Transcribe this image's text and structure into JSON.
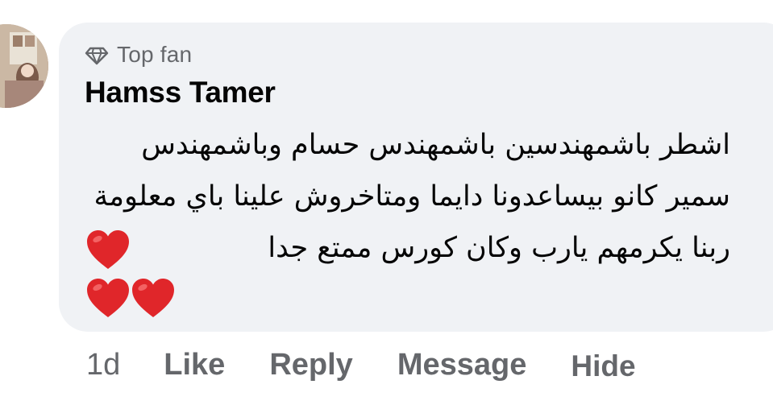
{
  "comment": {
    "badge": {
      "icon": "diamond-icon",
      "label": "Top fan"
    },
    "author": "Hamss Tamer",
    "text": "اشطر باشمهندسين باشمهندس حسام وباشمهندس سمير كانو بيساعدونا دايما ومتاخروش علينا باي معلومة ربنا يكرمهم يارب وكان كورس ممتع جدا",
    "emoji": [
      "heart-emoji",
      "heart-emoji",
      "heart-emoji"
    ],
    "heart_color": "#e0262a",
    "bubble_color": "#f0f2f5"
  },
  "actions": {
    "time": "1d",
    "like": "Like",
    "reply": "Reply",
    "message": "Message",
    "hide": "Hide"
  },
  "colors": {
    "secondary_text": "#65676b",
    "primary_text": "#050505"
  }
}
